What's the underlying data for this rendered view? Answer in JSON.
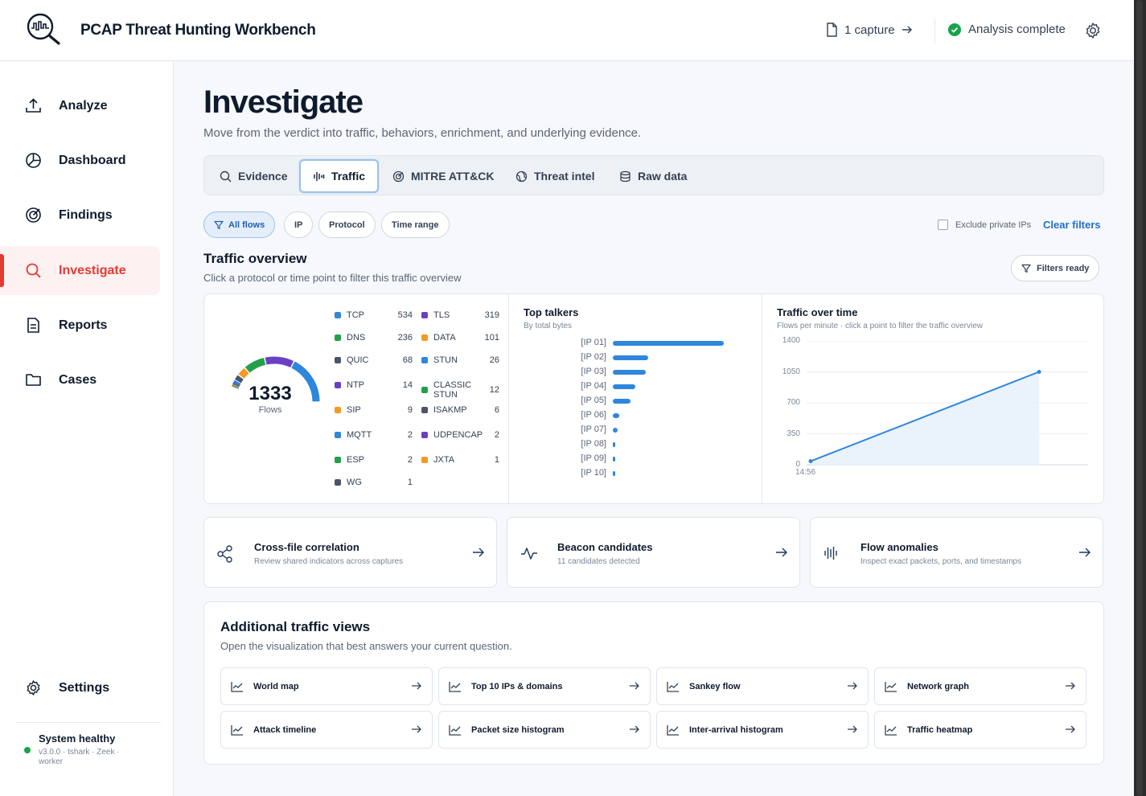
{
  "app": {
    "title": "PCAP Threat Hunting Workbench",
    "capture_label": "1 capture",
    "status_label": "Analysis complete"
  },
  "colors": {
    "accent": "#1e6fd0",
    "active_nav": "#e53935",
    "success": "#16a34a"
  },
  "sidebar": {
    "items": [
      {
        "label": "Analyze",
        "icon": "upload-icon"
      },
      {
        "label": "Dashboard",
        "icon": "pie-chart-icon"
      },
      {
        "label": "Findings",
        "icon": "target-icon"
      },
      {
        "label": "Investigate",
        "icon": "search-icon",
        "active": true
      },
      {
        "label": "Reports",
        "icon": "document-icon"
      },
      {
        "label": "Cases",
        "icon": "folder-icon"
      }
    ],
    "settings_label": "Settings",
    "system": {
      "title": "System healthy",
      "detail": "v3.0.0 · tshark · Zeek · worker"
    }
  },
  "page": {
    "title": "Investigate",
    "subtitle": "Move from the verdict into traffic, behaviors, enrichment, and underlying evidence."
  },
  "tabs": [
    {
      "label": "Evidence",
      "icon": "search-icon"
    },
    {
      "label": "Traffic",
      "icon": "waveform-icon",
      "active": true
    },
    {
      "label": "MITRE ATT&CK",
      "icon": "target-icon"
    },
    {
      "label": "Threat intel",
      "icon": "globe-icon"
    },
    {
      "label": "Raw data",
      "icon": "database-icon"
    }
  ],
  "filters": {
    "chips": [
      {
        "label": "All flows",
        "active": true
      },
      {
        "label": "IP"
      },
      {
        "label": "Protocol"
      },
      {
        "label": "Time range"
      }
    ],
    "exclude_private_label": "Exclude private IPs",
    "exclude_private_checked": false,
    "clear_label": "Clear filters"
  },
  "overview": {
    "title": "Traffic overview",
    "subtitle": "Click a protocol or time point to filter this traffic overview",
    "filters_ready_label": "Filters ready"
  },
  "chart_data": [
    {
      "type": "pie",
      "total": "1333",
      "total_label": "Flows",
      "categories": [
        "TCP",
        "TLS",
        "DNS",
        "DATA",
        "QUIC",
        "STUN",
        "NTP",
        "CLASSIC STUN",
        "SIP",
        "ISAKMP",
        "MQTT",
        "UDPENCAP",
        "ESP",
        "JXTA",
        "WG"
      ],
      "values": [
        534,
        319,
        236,
        101,
        68,
        26,
        14,
        12,
        9,
        6,
        2,
        2,
        2,
        1,
        1
      ],
      "colors": [
        "#2f86dd",
        "#6b3fc4",
        "#22a04b",
        "#f39a23",
        "#4a5568",
        "#2f86dd",
        "#6b3fc4",
        "#22a04b",
        "#f39a23",
        "#4a5568",
        "#2f86dd",
        "#6b3fc4",
        "#22a04b",
        "#f39a23",
        "#4a5568"
      ]
    },
    {
      "type": "bar",
      "title": "Top talkers",
      "subtitle": "By total bytes",
      "categories": [
        "[IP 01]",
        "[IP 02]",
        "[IP 03]",
        "[IP 04]",
        "[IP 05]",
        "[IP 06]",
        "[IP 07]",
        "[IP 08]",
        "[IP 09]",
        "[IP 10]"
      ],
      "values": [
        100,
        32,
        30,
        20,
        16,
        6,
        4,
        2.5,
        1.5,
        1.5
      ],
      "orientation": "horizontal"
    },
    {
      "type": "area",
      "title": "Traffic over time",
      "subtitle": "Flows per minute · click a point to filter the traffic overview",
      "x": [
        "14:56",
        ""
      ],
      "values": [
        40,
        1050
      ],
      "ylim": [
        0,
        1400
      ],
      "yticks": [
        "1400",
        "1050",
        "700",
        "350",
        "0"
      ],
      "xticks": [
        "14:56"
      ],
      "grid": true
    }
  ],
  "quick_actions": [
    {
      "title": "Cross-file correlation",
      "subtitle": "Review shared indicators across captures",
      "icon": "share-icon"
    },
    {
      "title": "Beacon candidates",
      "subtitle": "11 candidates detected",
      "icon": "activity-icon"
    },
    {
      "title": "Flow anomalies",
      "subtitle": "Inspect exact packets, ports, and timestamps",
      "icon": "waveform-icon"
    }
  ],
  "additional": {
    "title": "Additional traffic views",
    "subtitle": "Open the visualization that best answers your current question.",
    "views": [
      "World map",
      "Top 10 IPs & domains",
      "Sankey flow",
      "Network graph",
      "Attack timeline",
      "Packet size histogram",
      "Inter-arrival histogram",
      "Traffic heatmap"
    ]
  }
}
